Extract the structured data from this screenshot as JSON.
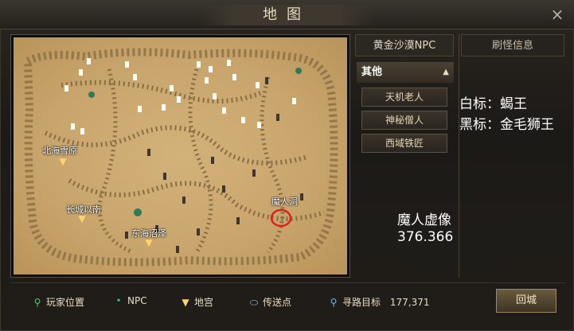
{
  "window": {
    "title": "地图",
    "close_icon": "×"
  },
  "map": {
    "labels": {
      "north_sea": "北海雪原",
      "changcheng": "长城以南",
      "east_sea": "东海沼泽",
      "demon_cave": "魔人洞"
    }
  },
  "tabs": {
    "npc": "黄金沙漠NPC",
    "spawn": "刷怪信息"
  },
  "npc_list": {
    "section": "其他",
    "items": [
      "天机老人",
      "神秘僧人",
      "西域铁匠"
    ]
  },
  "notes": {
    "white_marker": "白标：蝎王",
    "black_marker": "黑标：金毛狮王",
    "boss_name": "魔人虚像",
    "boss_coords": "376.366"
  },
  "legend": {
    "player": "玩家位置",
    "npc": "NPC",
    "dungeon": "地宫",
    "teleport": "传送点",
    "target_label": "寻路目标",
    "target_value": "177,371"
  },
  "buttons": {
    "home": "回城"
  },
  "colors": {
    "accent": "#e8dcc2",
    "map_sand": "#c7a46b",
    "circle": "#e02020"
  }
}
